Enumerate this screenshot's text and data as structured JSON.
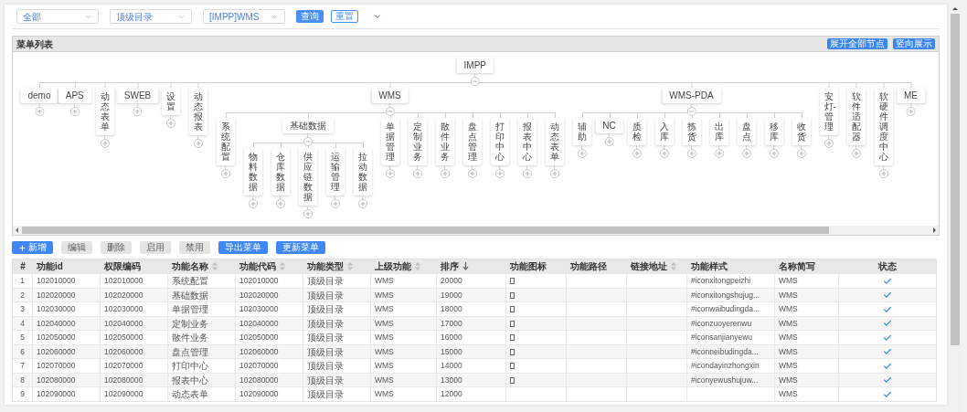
{
  "filters": [
    {
      "value": "全部"
    },
    {
      "value": "顶级目录"
    },
    {
      "value": "[IMPP]WMS"
    }
  ],
  "filter_buttons": [
    {
      "label": "查询",
      "kind": "primary"
    },
    {
      "label": "重置",
      "kind": "outline"
    }
  ],
  "panel": {
    "title": "菜单列表",
    "actions": [
      "展开全部节点",
      "竖向展示"
    ]
  },
  "tree": {
    "label": "IMPP",
    "kind": "horizontal",
    "expanded": true,
    "children": [
      {
        "label": "demo",
        "kind": "horizontal",
        "expanded": false
      },
      {
        "label": "APS",
        "kind": "horizontal",
        "expanded": false
      },
      {
        "label": "动态表单",
        "kind": "vertical",
        "expanded": false
      },
      {
        "label": "SWEB",
        "kind": "horizontal",
        "expanded": false
      },
      {
        "label": "设置",
        "kind": "vertical",
        "expanded": false
      },
      {
        "label": "动态报表",
        "kind": "vertical",
        "expanded": false
      },
      {
        "label": "WMS",
        "kind": "horizontal",
        "expanded": true,
        "children": [
          {
            "label": "系统配置",
            "kind": "vertical",
            "expanded": false
          },
          {
            "label": "基础数据",
            "kind": "horizontal",
            "expanded": true,
            "children": [
              {
                "label": "物料数据",
                "kind": "vertical",
                "expanded": false
              },
              {
                "label": "仓库数据",
                "kind": "vertical",
                "expanded": false
              },
              {
                "label": "供应链数据",
                "kind": "vertical",
                "expanded": false
              },
              {
                "label": "运输管理",
                "kind": "vertical",
                "expanded": false
              },
              {
                "label": "拉动数据",
                "kind": "vertical",
                "expanded": false
              }
            ]
          },
          {
            "label": "单据管理",
            "kind": "vertical",
            "expanded": false
          },
          {
            "label": "定制业务",
            "kind": "vertical",
            "expanded": false
          },
          {
            "label": "散件业务",
            "kind": "vertical",
            "expanded": false
          },
          {
            "label": "盘点管理",
            "kind": "vertical",
            "expanded": false
          },
          {
            "label": "打印中心",
            "kind": "vertical",
            "expanded": false
          },
          {
            "label": "报表中心",
            "kind": "vertical",
            "expanded": false
          },
          {
            "label": "动态表单",
            "kind": "vertical",
            "expanded": false
          }
        ]
      },
      {
        "label": "WMS-PDA",
        "kind": "horizontal",
        "expanded": true,
        "children": [
          {
            "label": "辅助",
            "kind": "vertical",
            "expanded": false
          },
          {
            "label": "NC",
            "kind": "horizontal",
            "expanded": false
          },
          {
            "label": "质检",
            "kind": "vertical",
            "expanded": false
          },
          {
            "label": "入库",
            "kind": "vertical",
            "expanded": false
          },
          {
            "label": "拣货",
            "kind": "vertical",
            "expanded": false
          },
          {
            "label": "出库",
            "kind": "vertical",
            "expanded": false
          },
          {
            "label": "盘点",
            "kind": "vertical",
            "expanded": false
          },
          {
            "label": "移库",
            "kind": "vertical",
            "expanded": false
          },
          {
            "label": "收货",
            "kind": "vertical",
            "expanded": false
          }
        ]
      },
      {
        "label": "安灯-管理",
        "kind": "vertical",
        "expanded": false
      },
      {
        "label": "软件适配器",
        "kind": "vertical",
        "expanded": false
      },
      {
        "label": "软硬件调度中心",
        "kind": "vertical",
        "expanded": false
      },
      {
        "label": "ME",
        "kind": "horizontal",
        "expanded": false
      }
    ]
  },
  "toolbar": [
    {
      "label": "新增",
      "kind": "add",
      "disabled": false
    },
    {
      "label": "编辑",
      "kind": "plain",
      "disabled": true
    },
    {
      "label": "删除",
      "kind": "plain",
      "disabled": true
    },
    {
      "label": "启用",
      "kind": "plain",
      "disabled": true
    },
    {
      "label": "禁用",
      "kind": "plain",
      "disabled": true
    },
    {
      "label": "导出菜单",
      "kind": "plain",
      "disabled": false
    },
    {
      "label": "更新菜单",
      "kind": "plain",
      "disabled": false
    }
  ],
  "table": {
    "columns": [
      {
        "label": "#",
        "sortable": false,
        "sorted": false
      },
      {
        "label": "功能id",
        "sortable": false,
        "sorted": false
      },
      {
        "label": "权限编码",
        "sortable": false,
        "sorted": false
      },
      {
        "label": "功能名称",
        "sortable": true,
        "sorted": false
      },
      {
        "label": "功能代码",
        "sortable": true,
        "sorted": false
      },
      {
        "label": "功能类型",
        "sortable": true,
        "sorted": false
      },
      {
        "label": "上级功能",
        "sortable": true,
        "sorted": false
      },
      {
        "label": "排序",
        "sortable": true,
        "sorted": true
      },
      {
        "label": "功能图标",
        "sortable": false,
        "sorted": false
      },
      {
        "label": "功能路径",
        "sortable": false,
        "sorted": false
      },
      {
        "label": "链接地址",
        "sortable": true,
        "sorted": false
      },
      {
        "label": "功能样式",
        "sortable": false,
        "sorted": false
      },
      {
        "label": "名称简写",
        "sortable": false,
        "sorted": false
      },
      {
        "label": "状态",
        "sortable": false,
        "sorted": false
      }
    ],
    "rows": [
      {
        "index": "1",
        "id": "102010000",
        "permission_code": "102010000",
        "name": "系统配置",
        "code": "102010000",
        "type": "顶级目录",
        "parent": "WMS",
        "order": "20000",
        "has_icon": true,
        "style": "#iconxitongpeizhi",
        "abbreviation": "WMS",
        "enabled": true
      },
      {
        "index": "2",
        "id": "102020000",
        "permission_code": "102020000",
        "name": "基础数据",
        "code": "102020000",
        "type": "顶级目录",
        "parent": "WMS",
        "order": "19000",
        "has_icon": true,
        "style": "#iconxitongshujug...",
        "abbreviation": "WMS",
        "enabled": true
      },
      {
        "index": "3",
        "id": "102030000",
        "permission_code": "102030000",
        "name": "单据管理",
        "code": "102030000",
        "type": "顶级目录",
        "parent": "WMS",
        "order": "18000",
        "has_icon": true,
        "style": "#iconwaibudingda...",
        "abbreviation": "WMS",
        "enabled": true
      },
      {
        "index": "4",
        "id": "102040000",
        "permission_code": "102040000",
        "name": "定制业务",
        "code": "102040000",
        "type": "顶级目录",
        "parent": "WMS",
        "order": "17000",
        "has_icon": true,
        "style": "#iconzuoyerenwu",
        "abbreviation": "WMS",
        "enabled": true
      },
      {
        "index": "5",
        "id": "102050000",
        "permission_code": "102050000",
        "name": "散件业务",
        "code": "102050000",
        "type": "顶级目录",
        "parent": "WMS",
        "order": "16000",
        "has_icon": true,
        "style": "#iconsanjianyewu",
        "abbreviation": "WMS",
        "enabled": true
      },
      {
        "index": "6",
        "id": "102060000",
        "permission_code": "102060000",
        "name": "盘点管理",
        "code": "102060000",
        "type": "顶级目录",
        "parent": "WMS",
        "order": "15000",
        "has_icon": true,
        "style": "#iconneibudingda...",
        "abbreviation": "WMS",
        "enabled": true
      },
      {
        "index": "7",
        "id": "102070000",
        "permission_code": "102070000",
        "name": "打印中心",
        "code": "102070000",
        "type": "顶级目录",
        "parent": "WMS",
        "order": "14000",
        "has_icon": true,
        "style": "#icondayinzhongxin",
        "abbreviation": "WMS",
        "enabled": true
      },
      {
        "index": "8",
        "id": "102080000",
        "permission_code": "102080000",
        "name": "报表中心",
        "code": "102080000",
        "type": "顶级目录",
        "parent": "WMS",
        "order": "13000",
        "has_icon": true,
        "style": "#iconyewushujuw...",
        "abbreviation": "WMS",
        "enabled": true
      },
      {
        "index": "9",
        "id": "102090000",
        "permission_code": "102090000",
        "name": "动态表单",
        "code": "102090000",
        "type": "顶级目录",
        "parent": "WMS",
        "order": "12000",
        "has_icon": false,
        "abbreviation": "WMS",
        "enabled": true
      }
    ]
  }
}
